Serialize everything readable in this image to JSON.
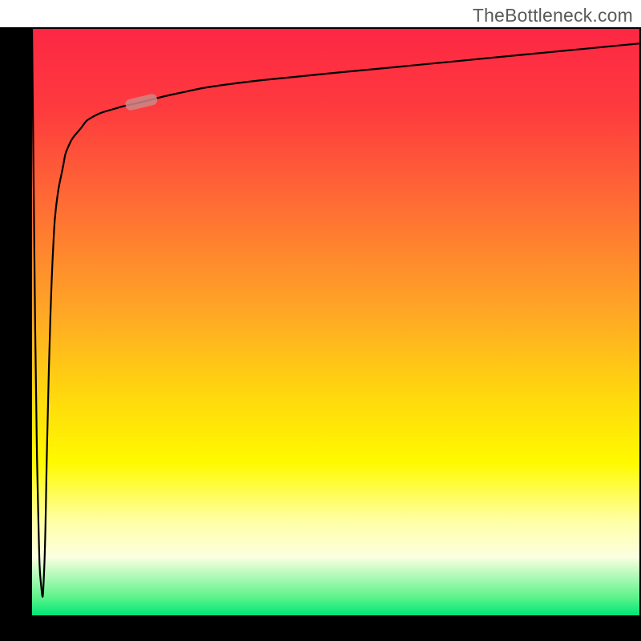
{
  "watermark": "TheBottleneck.com",
  "chart_data": {
    "type": "line",
    "title": "",
    "xlabel": "",
    "ylabel": "",
    "xlim": [
      0,
      100
    ],
    "ylim": [
      0,
      100
    ],
    "grid": false,
    "legend": false,
    "annotations": [
      {
        "kind": "marker",
        "x": 18,
        "y": 87.5
      }
    ],
    "series": [
      {
        "name": "curve",
        "x": [
          0,
          0.5,
          1.0,
          1.5,
          2.0,
          2.5,
          3.0,
          3.5,
          4.0,
          5.0,
          6.0,
          8.0,
          10.0,
          14.0,
          18.0,
          24.0,
          32.0,
          45.0,
          60.0,
          80.0,
          100.0
        ],
        "y": [
          100,
          50,
          18,
          5,
          8,
          30,
          50,
          63,
          70,
          76,
          80,
          83,
          85,
          86.5,
          87.5,
          89,
          90.5,
          92,
          93.5,
          95.5,
          97.5
        ]
      }
    ],
    "background_gradient_stops": [
      {
        "pos": 0,
        "color": "#fd2744"
      },
      {
        "pos": 14,
        "color": "#fe3b3e"
      },
      {
        "pos": 30,
        "color": "#ff6d34"
      },
      {
        "pos": 48,
        "color": "#ffa626"
      },
      {
        "pos": 62,
        "color": "#ffd60e"
      },
      {
        "pos": 74,
        "color": "#fffa00"
      },
      {
        "pos": 84,
        "color": "#ffffa6"
      },
      {
        "pos": 90,
        "color": "#fcffe0"
      },
      {
        "pos": 97,
        "color": "#5bf38a"
      },
      {
        "pos": 100,
        "color": "#00e676"
      }
    ]
  }
}
